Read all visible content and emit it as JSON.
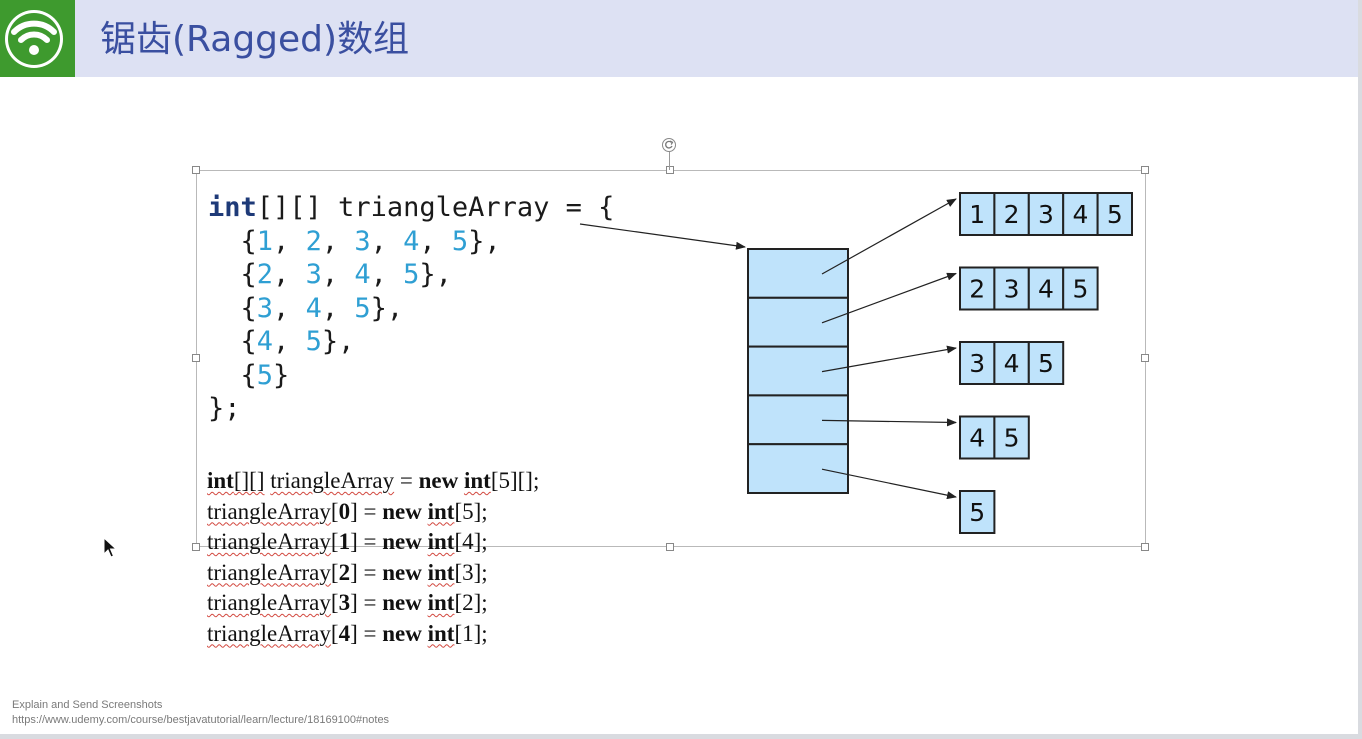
{
  "window": {
    "title": "锯齿(Ragged)数组"
  },
  "colors": {
    "header_bg": "#dde1f3",
    "logo_green": "#3e9a2e",
    "title_blue": "#3a4fa0",
    "keyword": "#1e3a78",
    "number": "#2f9fd3",
    "cell_fill": "#bfe3fb"
  },
  "icons": {
    "logo": "wifi-signal-icon",
    "rotate": "rotate-handle-icon",
    "cursor": "mouse-pointer-icon"
  },
  "code_block": {
    "decl_type": "int",
    "decl_rest": "[][] triangleArray = {",
    "rows": [
      {
        "values": [
          "1",
          "2",
          "3",
          "4",
          "5"
        ],
        "suffix": "},"
      },
      {
        "values": [
          "2",
          "3",
          "4",
          "5"
        ],
        "suffix": "},"
      },
      {
        "values": [
          "3",
          "4",
          "5"
        ],
        "suffix": "},"
      },
      {
        "values": [
          "4",
          "5"
        ],
        "suffix": "},"
      },
      {
        "values": [
          "5"
        ],
        "suffix": "}"
      }
    ],
    "close": "};"
  },
  "serif_code": {
    "line1": {
      "kw": "int",
      "brackets": "[][]",
      "var": "triangleArray",
      "eq": " = ",
      "new_kw": "new",
      "type": "int",
      "dims": "[5][];"
    },
    "lines": [
      {
        "var": "triangleArray",
        "index": "0",
        "size": "5"
      },
      {
        "var": "triangleArray",
        "index": "1",
        "size": "4"
      },
      {
        "var": "triangleArray",
        "index": "2",
        "size": "3"
      },
      {
        "var": "triangleArray",
        "index": "3",
        "size": "2"
      },
      {
        "var": "triangleArray",
        "index": "4",
        "size": "1"
      }
    ],
    "eq": " = ",
    "new_kw": "new",
    "type": "int"
  },
  "diagram": {
    "row_arrays": [
      [
        "1",
        "2",
        "3",
        "4",
        "5"
      ],
      [
        "2",
        "3",
        "4",
        "5"
      ],
      [
        "3",
        "4",
        "5"
      ],
      [
        "4",
        "5"
      ],
      [
        "5"
      ]
    ]
  },
  "status": {
    "line1": "Explain and Send Screenshots",
    "line2": "https://www.udemy.com/course/bestjavatutorial/learn/lecture/18169100#notes"
  }
}
